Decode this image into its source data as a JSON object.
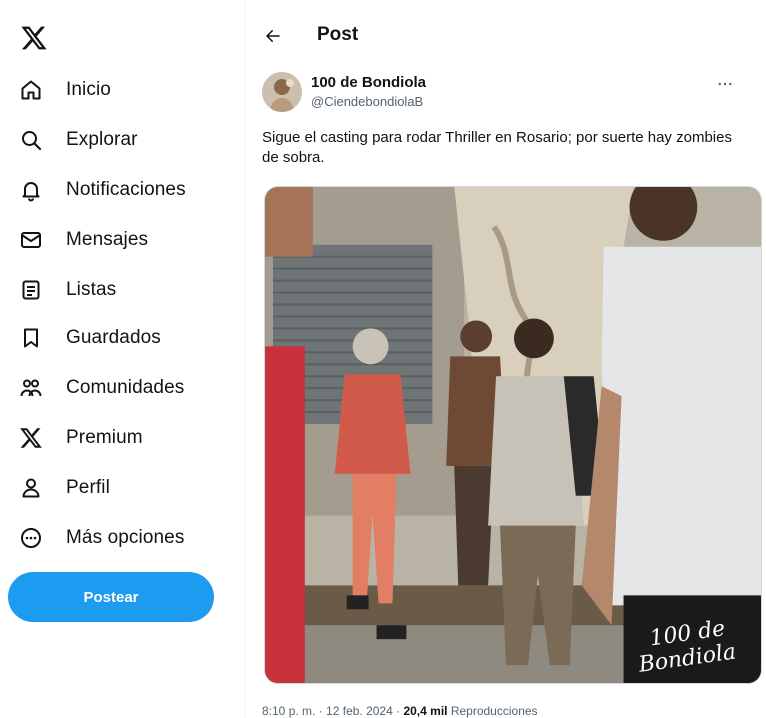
{
  "sidebar": {
    "logo_icon": "x-logo-icon",
    "items": [
      {
        "label": "Inicio",
        "icon": "home-icon"
      },
      {
        "label": "Explorar",
        "icon": "search-icon"
      },
      {
        "label": "Notificaciones",
        "icon": "bell-icon"
      },
      {
        "label": "Mensajes",
        "icon": "envelope-icon"
      },
      {
        "label": "Listas",
        "icon": "list-icon"
      },
      {
        "label": "Guardados",
        "icon": "bookmark-icon"
      },
      {
        "label": "Comunidades",
        "icon": "people-icon"
      },
      {
        "label": "Premium",
        "icon": "x-logo-icon"
      },
      {
        "label": "Perfil",
        "icon": "person-icon"
      },
      {
        "label": "Más opciones",
        "icon": "more-circle-icon"
      }
    ],
    "post_button_label": "Postear"
  },
  "header": {
    "title": "Post",
    "back_icon": "arrow-left-icon"
  },
  "post": {
    "author_name": "100 de Bondiola",
    "author_handle": "@CiendebondiolaB",
    "text": "Sigue el casting para rodar Thriller en Rosario; por suerte hay zombies de sobra.",
    "media_watermark_line1": "100 de",
    "media_watermark_line2": "Bondiola",
    "meta_time": "8:10 p. m.",
    "meta_separator": " · ",
    "meta_date": "12 feb. 2024",
    "meta_views_count": "20,4 mil",
    "meta_views_label": " Reproducciones"
  },
  "colors": {
    "accent": "#1d9bf0",
    "text_primary": "#0f1419",
    "text_secondary": "#536471"
  }
}
